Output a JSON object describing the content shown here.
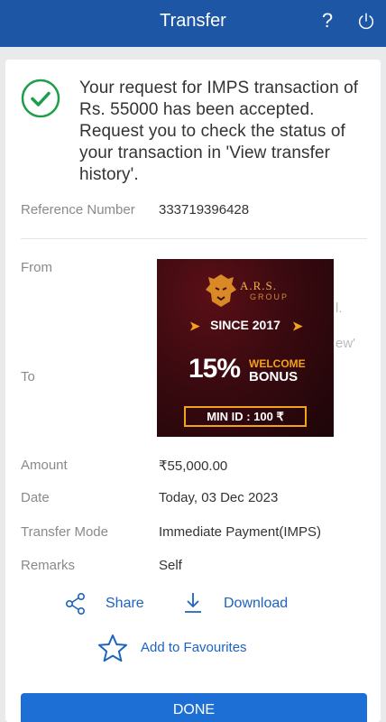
{
  "header": {
    "title": "Transfer",
    "help_label": "?",
    "power_icon": "power-icon"
  },
  "status": {
    "icon": "check-circle-icon",
    "message": "Your request for IMPS transaction of Rs. 55000 has been accepted. Request you to check the status of your transaction in 'View transfer history'."
  },
  "reference": {
    "label": "Reference Number",
    "value": "333719396428"
  },
  "from": {
    "label": "From"
  },
  "to": {
    "label": "To"
  },
  "partially_visible_text": {
    "fragment_1": "l.",
    "fragment_2": "ew'"
  },
  "ad": {
    "brand": "A.R.S.",
    "group": "GROUP",
    "since": "SINCE 2017",
    "percent": "15%",
    "welcome": "WELCOME",
    "bonus": "BONUS",
    "min_id": "MIN ID : 100 ₹"
  },
  "details": [
    {
      "label": "Amount",
      "value": "₹55,000.00"
    },
    {
      "label": "Date",
      "value": "Today, 03 Dec 2023"
    },
    {
      "label": "Transfer Mode",
      "value": "Immediate Payment(IMPS)"
    },
    {
      "label": "Remarks",
      "value": "Self"
    }
  ],
  "actions": {
    "share": "Share",
    "download": "Download",
    "favourites": "Add to Favourites",
    "done": "DONE"
  },
  "colors": {
    "header": "#1d56a4",
    "accent": "#1d63c0",
    "success": "#1e9e4b",
    "done_button": "#1d6fd6"
  }
}
